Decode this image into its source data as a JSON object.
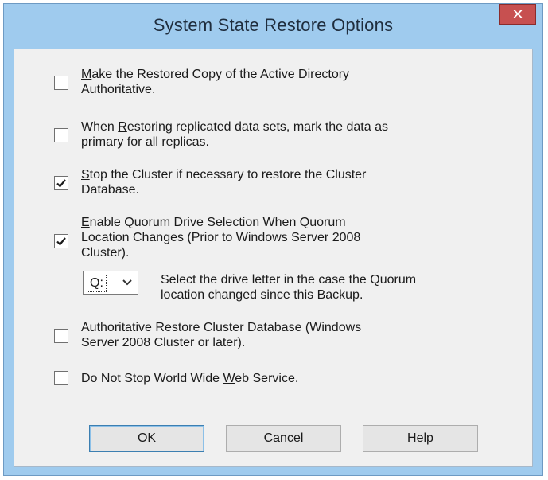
{
  "window": {
    "title": "System State Restore Options",
    "close_glyph": "✕"
  },
  "options": [
    {
      "key": "m",
      "pre": "",
      "post": "ake the Restored Copy of the Active Directory",
      "line2": "Authoritative.",
      "checked": false
    },
    {
      "key": "R",
      "pre": "When ",
      "post": "estoring replicated data sets, mark the data as",
      "line2": "primary for all replicas.",
      "checked": false
    },
    {
      "key": "S",
      "pre": "",
      "post": "top the Cluster if necessary to restore the Cluster",
      "line2": "Database.",
      "checked": true
    },
    {
      "key": "E",
      "pre": "",
      "post": "nable Quorum Drive Selection When Quorum",
      "line2": "Location Changes (Prior to Windows Server 2008",
      "line3": "Cluster).",
      "checked": true
    },
    {
      "pre": "Authoritative Restore Cluster Database (Windows",
      "line2": "Server 2008 Cluster or later).",
      "checked": false
    },
    {
      "key": "W",
      "pre": "Do Not Stop World Wide ",
      "post": "eb Service.",
      "checked": false
    }
  ],
  "quorum": {
    "drive_value": "Q:",
    "desc_line1": "Select the drive letter in the case the Quorum",
    "desc_line2": "location changed since this Backup."
  },
  "buttons": {
    "ok_key": "O",
    "ok_rest": "K",
    "cancel_key": "C",
    "cancel_rest": "ancel",
    "help_key": "H",
    "help_rest": "elp"
  },
  "icons": {
    "close": "close-icon",
    "check": "checkmark-icon",
    "dropdown": "chevron-down-icon"
  }
}
